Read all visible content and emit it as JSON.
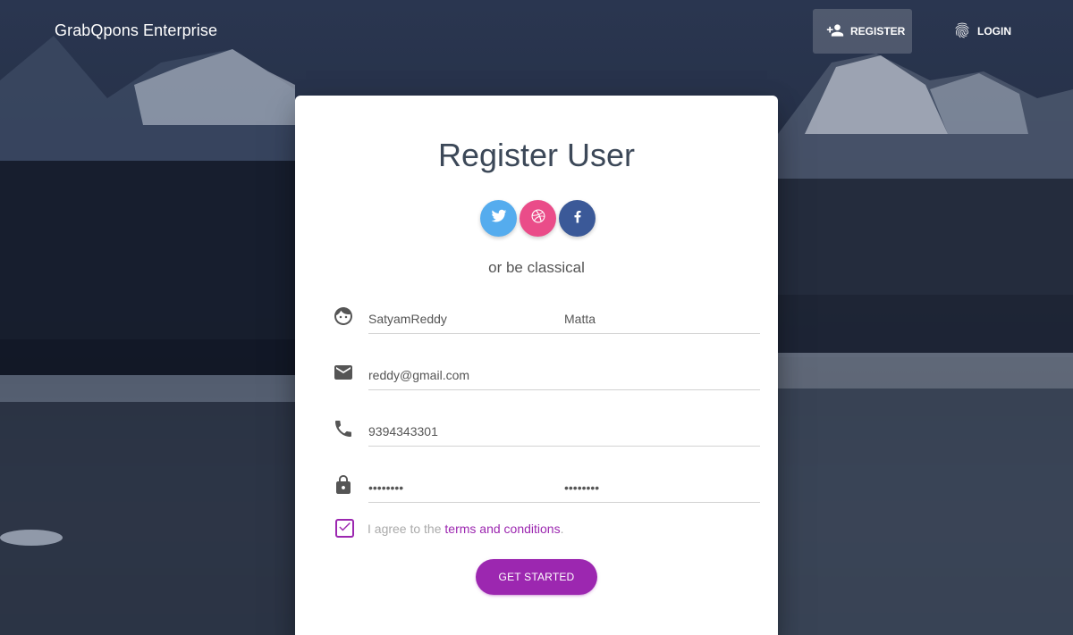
{
  "navbar": {
    "brand": "GrabQpons Enterprise",
    "register_label": "REGISTER",
    "login_label": "LOGIN"
  },
  "card": {
    "title": "Register User",
    "socials": [
      "twitter",
      "dribbble",
      "facebook"
    ],
    "subtitle": "or be classical",
    "fields": {
      "first_name": "SatyamReddy",
      "last_name": "Matta",
      "email": "reddy@gmail.com",
      "phone": "9394343301",
      "password": "••••••••",
      "confirm_password": "••••••••"
    },
    "agree_prefix": "I agree to the ",
    "agree_link": "terms and conditions",
    "agree_suffix": ".",
    "agree_checked": true,
    "cta_label": "GET STARTED"
  },
  "colors": {
    "accent": "#9c27b0",
    "twitter": "#55acee",
    "dribbble": "#ea4c89",
    "facebook": "#3b5998"
  },
  "icons": {
    "register": "person-add-icon",
    "login": "fingerprint-icon",
    "name": "face-icon",
    "email": "email-icon",
    "phone": "phone-icon",
    "password": "lock-icon",
    "check": "check-icon"
  }
}
